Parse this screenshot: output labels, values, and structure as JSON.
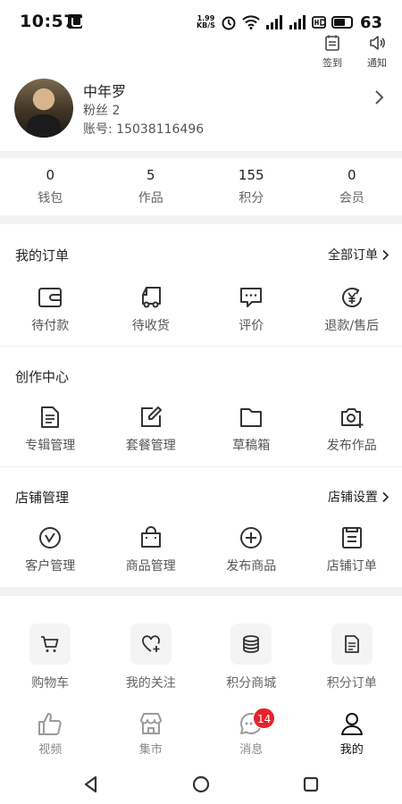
{
  "status_bar": {
    "time": "10:57",
    "net_speed_value": "1.99",
    "net_speed_unit": "KB/S",
    "battery_level": "63"
  },
  "top_actions": [
    {
      "label": "签到",
      "icon": "checkin-icon"
    },
    {
      "label": "通知",
      "icon": "speaker-icon"
    }
  ],
  "profile": {
    "name": "中年罗",
    "fans": "粉丝 2",
    "account": "账号: 15038116496"
  },
  "stats": [
    {
      "value": "0",
      "label": "钱包"
    },
    {
      "value": "5",
      "label": "作品"
    },
    {
      "value": "155",
      "label": "积分"
    },
    {
      "value": "0",
      "label": "会员"
    }
  ],
  "orders": {
    "title": "我的订单",
    "link": "全部订单",
    "items": [
      {
        "label": "待付款",
        "icon": "wallet-icon"
      },
      {
        "label": "待收货",
        "icon": "delivery-truck-icon"
      },
      {
        "label": "评价",
        "icon": "comment-icon"
      },
      {
        "label": "退款/售后",
        "icon": "refund-icon"
      }
    ]
  },
  "creation": {
    "title": "创作中心",
    "items": [
      {
        "label": "专辑管理",
        "icon": "album-doc-icon"
      },
      {
        "label": "套餐管理",
        "icon": "edit-icon"
      },
      {
        "label": "草稿箱",
        "icon": "folder-icon"
      },
      {
        "label": "发布作品",
        "icon": "camera-add-icon"
      }
    ]
  },
  "store": {
    "title": "店铺管理",
    "link": "店铺设置",
    "items": [
      {
        "label": "客户管理",
        "icon": "customer-icon"
      },
      {
        "label": "商品管理",
        "icon": "shopping-bag-icon"
      },
      {
        "label": "发布商品",
        "icon": "plus-circle-icon"
      },
      {
        "label": "店铺订单",
        "icon": "order-list-icon"
      }
    ]
  },
  "tools": [
    {
      "label": "购物车",
      "icon": "cart-icon"
    },
    {
      "label": "我的关注",
      "icon": "heart-plus-icon"
    },
    {
      "label": "积分商城",
      "icon": "coins-icon"
    },
    {
      "label": "积分订单",
      "icon": "doc-icon"
    }
  ],
  "tabbar": [
    {
      "label": "视频",
      "icon": "thumbs-up-icon"
    },
    {
      "label": "集市",
      "icon": "market-icon"
    },
    {
      "label": "消息",
      "icon": "chat-icon",
      "badge": "14"
    },
    {
      "label": "我的",
      "icon": "person-icon",
      "active": true
    }
  ],
  "colors": {
    "badge": "#e8212a",
    "band": "#f2f2f2"
  }
}
